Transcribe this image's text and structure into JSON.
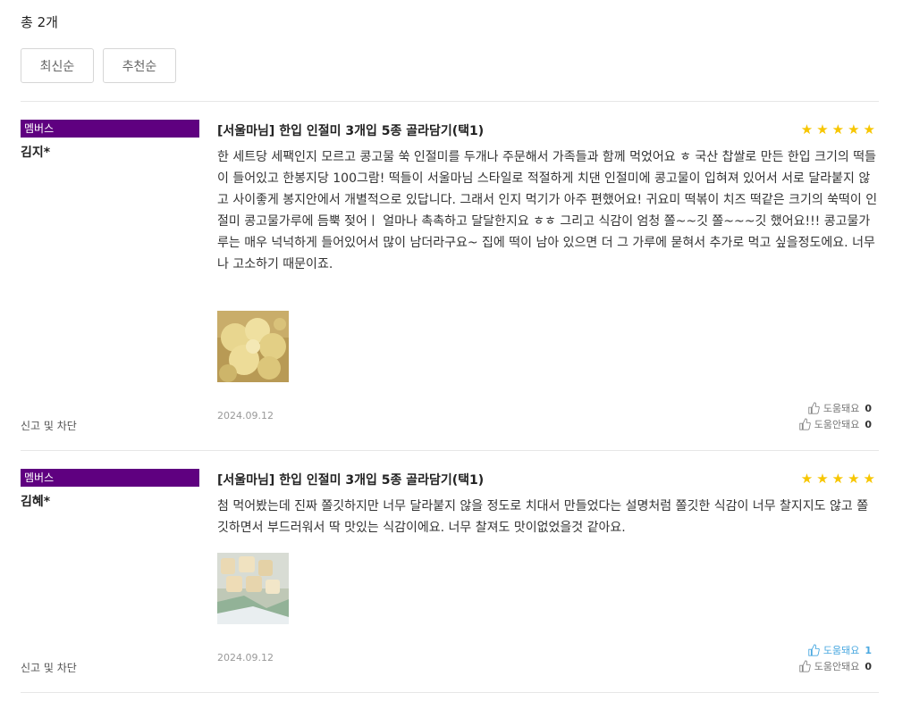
{
  "total_count": "총 2개",
  "sort_options": [
    "최신순",
    "추천순"
  ],
  "accent_color": "#5f0080",
  "star_color": "#f7c600",
  "reviews": [
    {
      "badge": "멤버스",
      "author": "김지*",
      "report": "신고 및 차단",
      "product_title": "[서울마님] 한입 인절미 3개입 5종 골라담기(택1)",
      "rating": 5,
      "stars": "★★★★★",
      "text": "한 세트당 세팩인지 모르고 콩고물 쑥 인절미를 두개나 주문해서 가족들과 함께 먹었어요 ㅎ 국산 찹쌀로 만든 한입 크기의 떡들이 들어있고 한봉지당 100그람! 떡들이 서울마님 스타일로 적절하게 치댄 인절미에 콩고물이 입혀져 있어서 서로 달라붙지 않고 사이좋게 봉지안에서 개별적으로 있답니다. 그래서 인지 먹기가 아주 편했어요! 귀요미 떡볶이 치즈 떡같은 크기의 쑥떡이 인절미 콩고물가루에 듬뿍 젖어ㅣ 얼마나 촉촉하고 달달한지요 ㅎㅎ 그리고 식감이 엄청 쫄~~깃 쫄~~~깃 했어요!!! 콩고물가루는 매우 넉넉하게 들어있어서 많이 남더라구요~ 집에 떡이 남아 있으면 더 그 가루에 묻혀서 추가로 먹고 싶을정도에요. 너무나 고소하기 때문이죠.",
      "date": "2024.09.12",
      "helpful_label": "도움돼요",
      "helpful_count": "0",
      "not_helpful_label": "도움안돼요",
      "not_helpful_count": "0"
    },
    {
      "badge": "멤버스",
      "author": "김혜*",
      "report": "신고 및 차단",
      "product_title": "[서울마님] 한입 인절미 3개입 5종 골라담기(택1)",
      "rating": 5,
      "stars": "★★★★★",
      "text": "첨 먹어봤는데 진짜 쫄깃하지만 너무 달라붙지 않을 정도로 치대서 만들었다는 설명처럼 쫄깃한 식감이 너무 찰지지도 않고 쫄깃하면서 부드러워서 딱 맛있는 식감이에요. 너무 찰져도 맛이없었을것 같아요.",
      "date": "2024.09.12",
      "helpful_label": "도움돼요",
      "helpful_count": "1",
      "not_helpful_label": "도움안돼요",
      "not_helpful_count": "0"
    }
  ]
}
